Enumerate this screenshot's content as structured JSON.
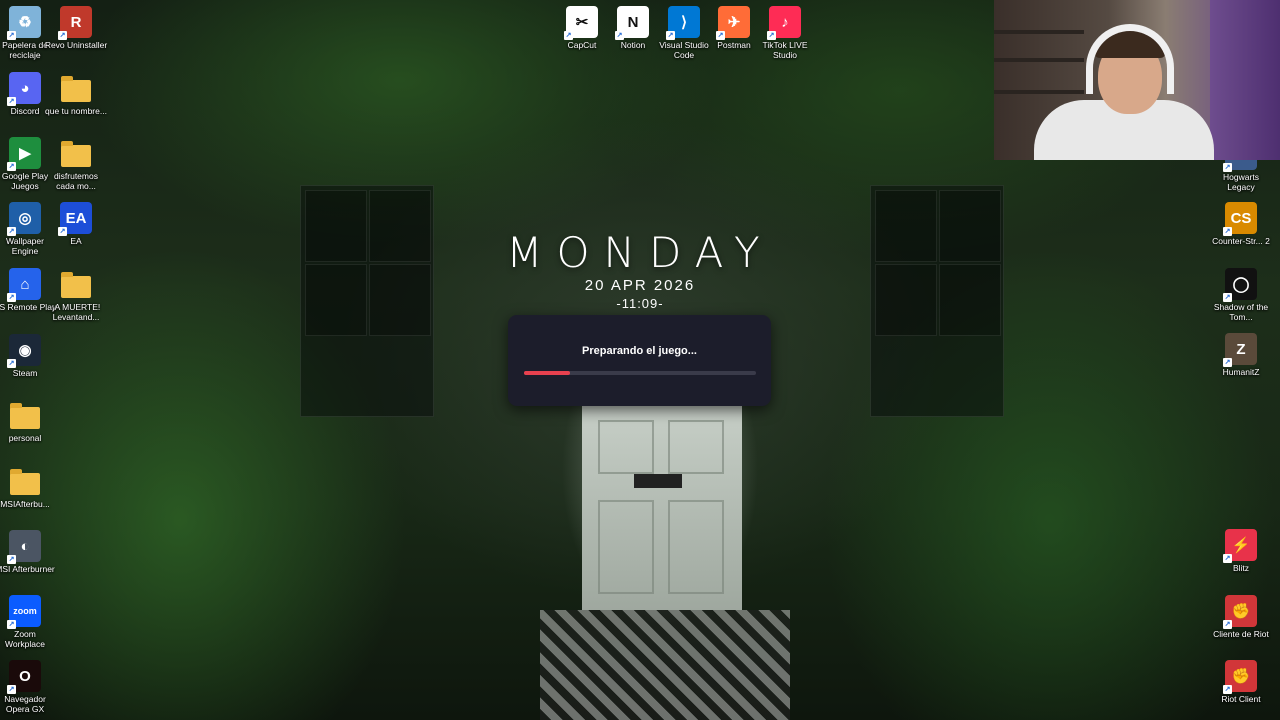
{
  "desktop": {
    "left_icons": [
      {
        "name": "recycle-bin-icon",
        "label": "Papelera de reciclaje",
        "glyph": "♻",
        "color": "#7fb3d9"
      },
      {
        "name": "revo-uninstaller-icon",
        "label": "Revo Uninstaller",
        "glyph": "R",
        "color": "#c0392b"
      },
      {
        "name": "discord-icon",
        "label": "Discord",
        "glyph": "◕",
        "color": "#5865f2"
      },
      {
        "name": "folder-icon",
        "label": "que tu nombre...",
        "glyph": "",
        "color": "#f2c04a"
      },
      {
        "name": "google-play-games-icon",
        "label": "Google Play Juegos",
        "glyph": "▶",
        "color": "#1e8e3e"
      },
      {
        "name": "folder-icon",
        "label": "disfrutemos cada mo...",
        "glyph": "",
        "color": "#f2c04a"
      },
      {
        "name": "wallpaper-engine-icon",
        "label": "Wallpaper Engine",
        "glyph": "◎",
        "color": "#1f5fa8"
      },
      {
        "name": "ea-icon",
        "label": "EA",
        "glyph": "EA",
        "color": "#1d4ed8"
      },
      {
        "name": "ps-remote-play-icon",
        "label": "PS Remote Play",
        "glyph": "⌂",
        "color": "#2563eb"
      },
      {
        "name": "folder-icon",
        "label": "¡A MUERTE! Levantand...",
        "glyph": "",
        "color": "#f2c04a"
      },
      {
        "name": "steam-icon",
        "label": "Steam",
        "glyph": "◉",
        "color": "#1b2838"
      },
      {
        "name": "personal-folder-icon",
        "label": "personal",
        "glyph": "",
        "color": "#f2c04a"
      },
      {
        "name": "msi-afterburner-folder-icon",
        "label": "MSIAfterbu...",
        "glyph": "",
        "color": "#f2c04a"
      },
      {
        "name": "msi-afterburner-icon",
        "label": "MSI Afterburner",
        "glyph": "◐",
        "color": "#4b5563"
      },
      {
        "name": "zoom-icon",
        "label": "Zoom Workplace",
        "glyph": "zoom",
        "color": "#0b5cff"
      },
      {
        "name": "opera-gx-icon",
        "label": "Navegador Opera GX",
        "glyph": "O",
        "color": "#1a0a0a"
      }
    ],
    "top_icons": [
      {
        "name": "capcut-icon",
        "label": "CapCut",
        "glyph": "✂",
        "color": "#ffffff"
      },
      {
        "name": "notion-icon",
        "label": "Notion",
        "glyph": "N",
        "color": "#ffffff"
      },
      {
        "name": "vscode-icon",
        "label": "Visual Studio Code",
        "glyph": "⟩",
        "color": "#0078d4"
      },
      {
        "name": "postman-icon",
        "label": "Postman",
        "glyph": "✈",
        "color": "#ff6c37"
      },
      {
        "name": "tiktok-live-studio-icon",
        "label": "TikTok LIVE Studio",
        "glyph": "♪",
        "color": "#fe2c55"
      }
    ],
    "right_icons": [
      {
        "name": "hogwarts-legacy-icon",
        "label": "Hogwarts Legacy",
        "glyph": "H",
        "color": "#3b5b8c"
      },
      {
        "name": "counter-strike-icon",
        "label": "Counter-Str... 2",
        "glyph": "CS",
        "color": "#d98a00"
      },
      {
        "name": "shadow-of-tomb-raider-icon",
        "label": "Shadow of the Tom...",
        "glyph": "◯",
        "color": "#111111"
      },
      {
        "name": "humanitz-icon",
        "label": "HumanitZ",
        "glyph": "Z",
        "color": "#5a4a3a"
      },
      {
        "name": "blitz-icon",
        "label": "Blitz",
        "glyph": "⚡",
        "color": "#e8324a"
      },
      {
        "name": "riot-client-es-icon",
        "label": "Cliente de Riot",
        "glyph": "✊",
        "color": "#d13639"
      },
      {
        "name": "riot-client-icon",
        "label": "Riot Client",
        "glyph": "✊",
        "color": "#d13639"
      }
    ]
  },
  "clock": {
    "day": "MONDAY",
    "date": "20 APR 2026",
    "time": "-11:09-"
  },
  "dialog": {
    "message": "Preparando el juego...",
    "progress": 0.2,
    "bar_color": "#e8414f"
  }
}
